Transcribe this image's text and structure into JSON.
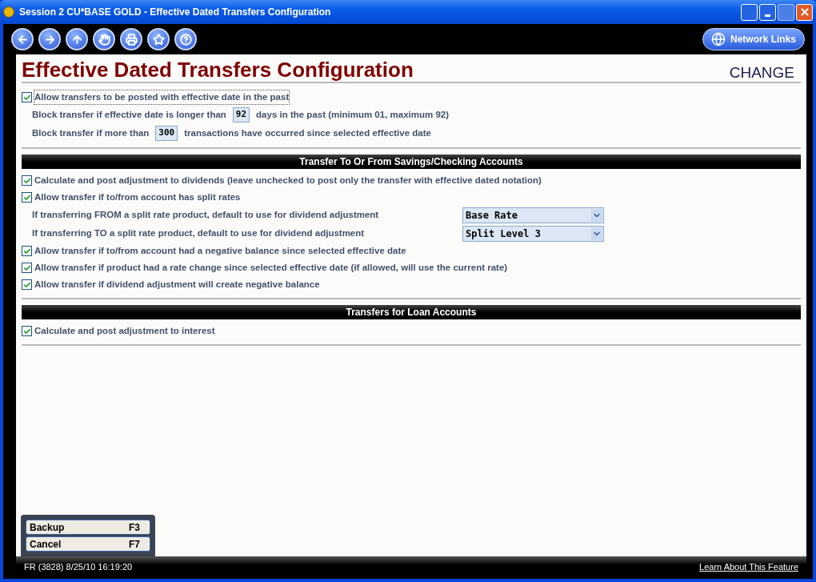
{
  "window": {
    "title": "Session 2 CU*BASE GOLD - Effective Dated Transfers Configuration"
  },
  "toolbar": {
    "buttons": [
      {
        "kind": "back"
      },
      {
        "kind": "forward"
      },
      {
        "kind": "up"
      },
      {
        "kind": "stop"
      },
      {
        "kind": "print"
      },
      {
        "kind": "favorite"
      },
      {
        "kind": "help"
      }
    ],
    "network_links": "Network Links"
  },
  "page": {
    "title": "Effective Dated Transfers Configuration",
    "mode": "CHANGE"
  },
  "sections": [
    {
      "items": [
        {
          "kind": "checkbox",
          "label": "Allow transfers to be posted with effective date in the past",
          "checked": true,
          "focused": true
        },
        {
          "kind": "number",
          "before": "Block transfer if effective date is longer than",
          "value": "92",
          "after": "days in the past (minimum 01, maximum 92)"
        },
        {
          "kind": "number",
          "before": "Block transfer if more than",
          "value": "300",
          "after": "transactions have occurred since selected effective date"
        }
      ]
    },
    {
      "heading": "Transfer To Or From Savings/Checking Accounts",
      "items": [
        {
          "kind": "checkbox",
          "label": "Calculate and post adjustment to dividends (leave unchecked to post only the transfer with effective dated notation)",
          "checked": true,
          "focused": false
        },
        {
          "kind": "checkbox",
          "label": "Allow transfer if to/from account has split rates",
          "checked": true,
          "focused": false
        },
        {
          "kind": "select",
          "label": "If transferring FROM a split rate product, default to use for dividend adjustment",
          "value": "Base Rate"
        },
        {
          "kind": "select",
          "label": "If transferring TO a split rate product, default to use for dividend adjustment",
          "value": "Split Level 3"
        },
        {
          "kind": "checkbox",
          "label": "Allow transfer if to/from account had a negative balance since selected effective date",
          "checked": true,
          "focused": false
        },
        {
          "kind": "checkbox",
          "label": "Allow transfer if product had a rate change since selected effective date (if allowed, will use the current rate)",
          "checked": true,
          "focused": false
        },
        {
          "kind": "checkbox",
          "label": "Allow transfer if dividend adjustment will create negative balance",
          "checked": true,
          "focused": false
        }
      ]
    },
    {
      "heading": "Transfers for Loan Accounts",
      "items": [
        {
          "kind": "checkbox",
          "label": "Calculate and post adjustment to interest",
          "checked": true,
          "focused": false
        }
      ]
    }
  ],
  "function_keys": [
    {
      "label": "Backup",
      "key": "F3"
    },
    {
      "label": "Cancel",
      "key": "F7"
    }
  ],
  "status_bar": {
    "session_info": "FR (3828) 8/25/10 16:19:20",
    "link": "Learn About This Feature"
  }
}
